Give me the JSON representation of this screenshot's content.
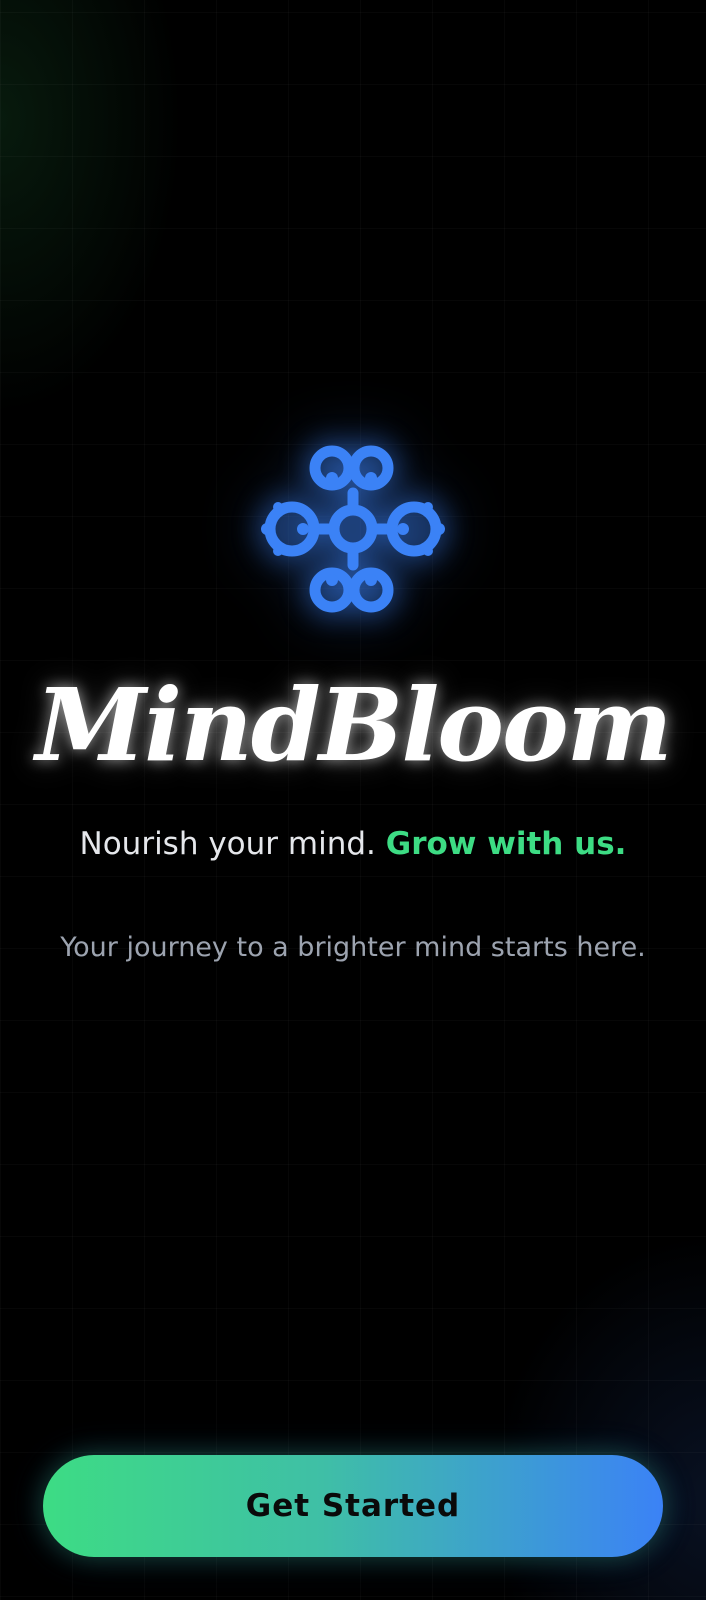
{
  "app": {
    "name": "MindBloom",
    "logo_icon": "flower-bloom-icon",
    "brand_blue": "#3b82f6",
    "brand_green": "#3ddc84"
  },
  "hero": {
    "tagline_prefix": "Nourish your mind.",
    "tagline_accent": "Grow with us.",
    "subtitle": "Your journey to a brighter mind starts here."
  },
  "actions": {
    "get_started_label": "Get Started"
  }
}
